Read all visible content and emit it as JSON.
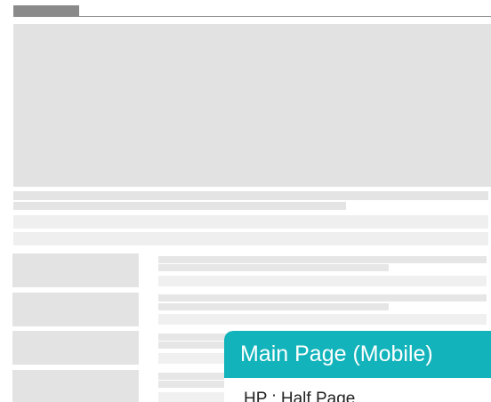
{
  "overlay_card": {
    "title": "Main Page (Mobile)",
    "body": "HP   : Half Page",
    "accent_color": "#12b3bb"
  },
  "wireframe": {
    "placeholder_color": "#e3e3e3",
    "header_tab_color": "#8a8a8a"
  }
}
